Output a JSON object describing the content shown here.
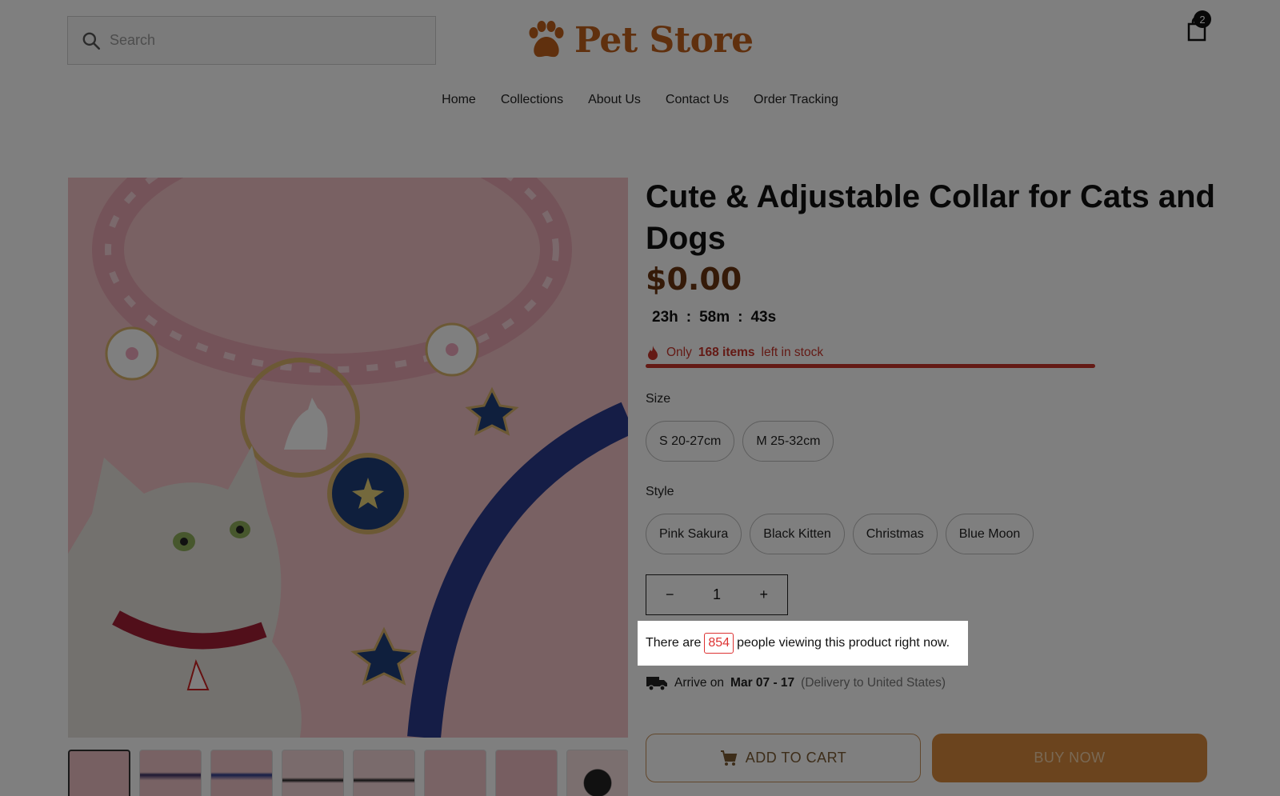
{
  "header": {
    "search_placeholder": "Search",
    "brand": "Pet Store",
    "cart_count": "2"
  },
  "nav": [
    "Home",
    "Collections",
    "About Us",
    "Contact Us",
    "Order Tracking"
  ],
  "product": {
    "title": "Cute & Adjustable Collar for Cats and Dogs",
    "price": "$0.00",
    "timer": {
      "hours": "23h",
      "sep1": ":",
      "minutes": "58m",
      "sep2": ":",
      "seconds": "43s"
    },
    "stock": {
      "prefix": "Only",
      "count": "168 items",
      "suffix": "left in stock",
      "level": 1.0
    },
    "size_label": "Size",
    "sizes": [
      "S 20-27cm",
      "M 25-32cm"
    ],
    "style_label": "Style",
    "styles": [
      "Pink Sakura",
      "Black Kitten",
      "Christmas",
      "Blue Moon"
    ],
    "quantity": {
      "minus": "−",
      "value": "1",
      "plus": "+"
    },
    "viewers": {
      "prefix": "There are",
      "count": "854",
      "suffix": "people viewing this product right now."
    },
    "delivery": {
      "prefix": "Arrive on",
      "dates": "Mar 07 - 17",
      "note": "(Delivery to United States)"
    },
    "add_to_cart": "ADD TO CART",
    "buy_now": "BUY NOW"
  },
  "colors": {
    "brand": "#c0611d",
    "price": "#6a3410",
    "stock": "#c8352b",
    "buy": "#d7893d"
  }
}
